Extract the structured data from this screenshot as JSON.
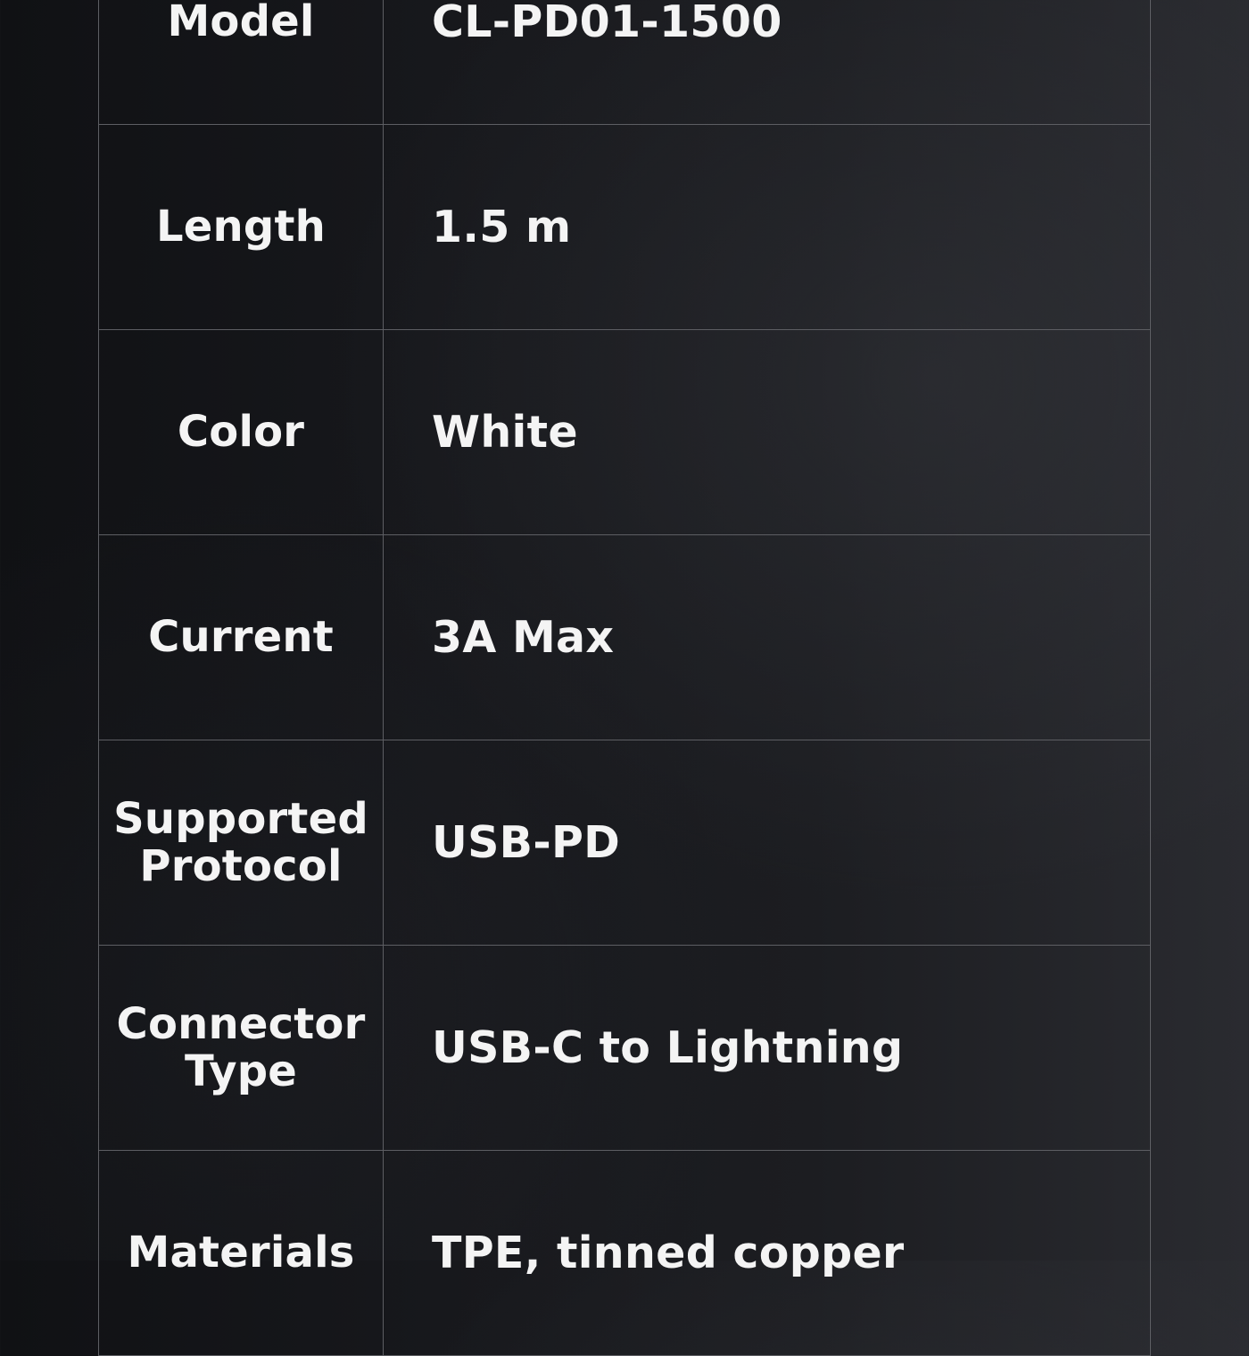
{
  "spec_table": {
    "rows": [
      {
        "label": "Model",
        "value": "CL-PD01-1500"
      },
      {
        "label": "Length",
        "value": "1.5 m"
      },
      {
        "label": "Color",
        "value": "White"
      },
      {
        "label": "Current",
        "value": "3A Max"
      },
      {
        "label": "Supported Protocol",
        "value": "USB-PD"
      },
      {
        "label": "Connector Type",
        "value": "USB-C to Lightning"
      },
      {
        "label": "Materials",
        "value": "TPE, tinned copper"
      }
    ]
  }
}
